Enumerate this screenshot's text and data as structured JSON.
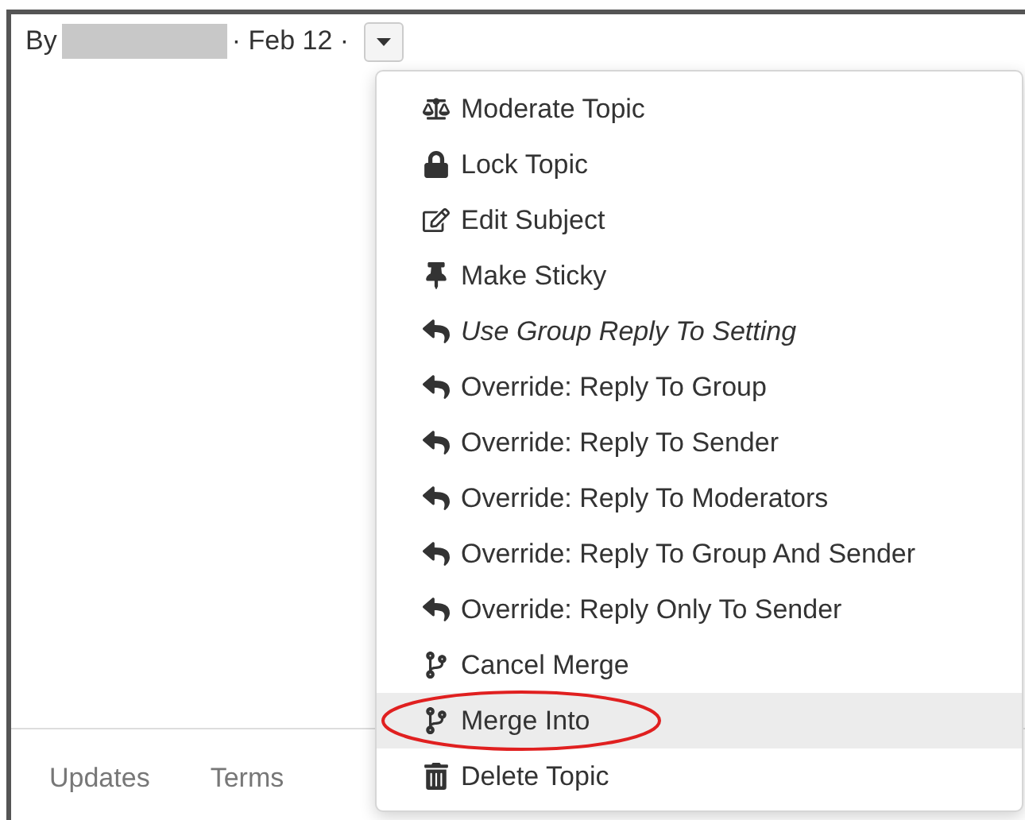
{
  "post_header": {
    "by_label": "By",
    "date": "· Feb 12 ·"
  },
  "menu": {
    "items": [
      {
        "label": "Moderate Topic",
        "kind": "moderate",
        "italic": false,
        "highlighted": false,
        "circled": false
      },
      {
        "label": "Lock Topic",
        "kind": "lock",
        "italic": false,
        "highlighted": false,
        "circled": false
      },
      {
        "label": "Edit Subject",
        "kind": "edit",
        "italic": false,
        "highlighted": false,
        "circled": false
      },
      {
        "label": "Make Sticky",
        "kind": "sticky",
        "italic": false,
        "highlighted": false,
        "circled": false
      },
      {
        "label": "Use Group Reply To Setting",
        "kind": "reply",
        "italic": true,
        "highlighted": false,
        "circled": false
      },
      {
        "label": "Override: Reply To Group",
        "kind": "reply",
        "italic": false,
        "highlighted": false,
        "circled": false
      },
      {
        "label": "Override: Reply To Sender",
        "kind": "reply",
        "italic": false,
        "highlighted": false,
        "circled": false
      },
      {
        "label": "Override: Reply To Moderators",
        "kind": "reply",
        "italic": false,
        "highlighted": false,
        "circled": false
      },
      {
        "label": "Override: Reply To Group And Sender",
        "kind": "reply",
        "italic": false,
        "highlighted": false,
        "circled": false
      },
      {
        "label": "Override: Reply Only To Sender",
        "kind": "reply",
        "italic": false,
        "highlighted": false,
        "circled": false
      },
      {
        "label": "Cancel Merge",
        "kind": "merge",
        "italic": false,
        "highlighted": false,
        "circled": false
      },
      {
        "label": "Merge Into",
        "kind": "merge",
        "italic": false,
        "highlighted": true,
        "circled": true
      },
      {
        "label": "Delete Topic",
        "kind": "delete",
        "italic": false,
        "highlighted": false,
        "circled": false
      }
    ]
  },
  "footer": {
    "links": [
      "Updates",
      "Terms"
    ]
  }
}
